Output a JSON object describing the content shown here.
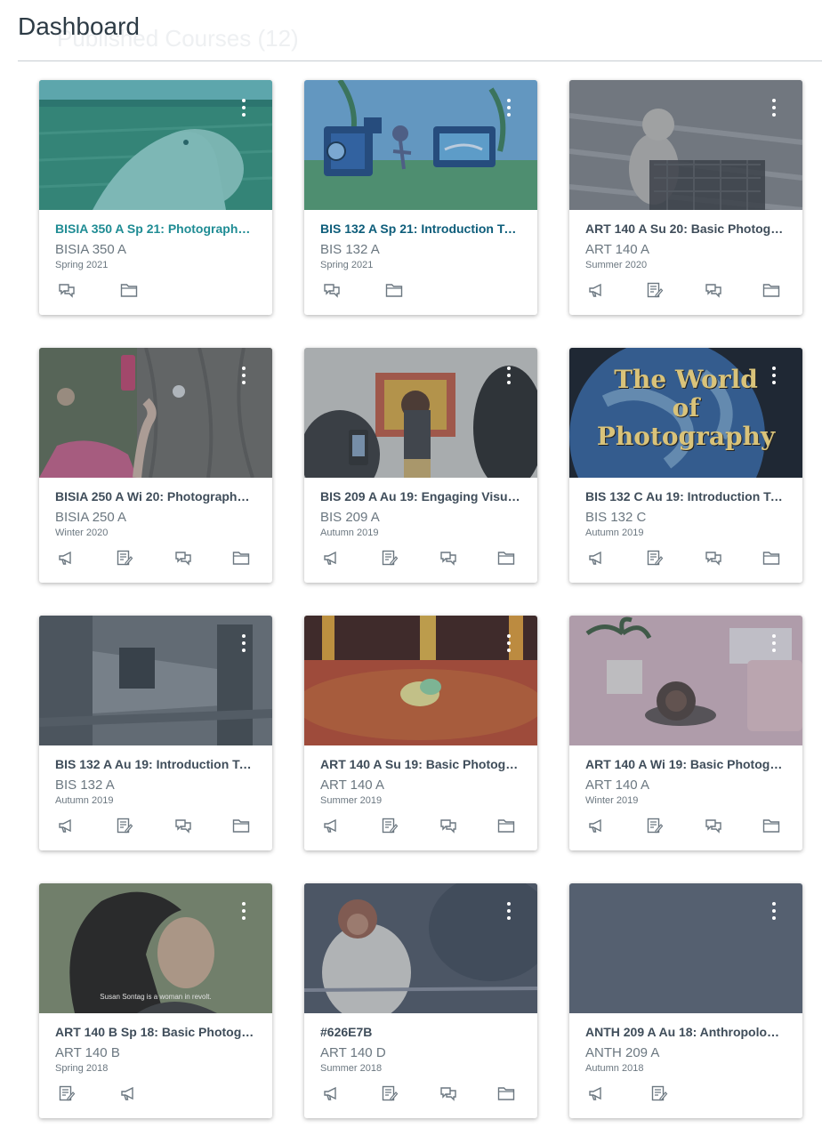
{
  "header": {
    "title": "Dashboard",
    "ghost_title": "Published Courses (12)"
  },
  "cards": [
    {
      "name": "BISIA 350 A Sp 21: Photography A...",
      "code": "BISIA 350 A",
      "term": "Spring 2021",
      "color": "#1f8c94",
      "actions": [
        "discussions-icon",
        "files-icon"
      ]
    },
    {
      "name": "BIS 132 A Sp 21: Introduction To P...",
      "code": "BIS 132 A",
      "term": "Spring 2021",
      "color": "#0d5d7a",
      "actions": [
        "discussions-icon",
        "files-icon"
      ]
    },
    {
      "name": "ART 140 A Su 20: Basic Photograp...",
      "code": "ART 140 A",
      "term": "Summer 2020",
      "color": "#3f4d5a",
      "actions": [
        "announcements-icon",
        "assignments-icon",
        "discussions-icon",
        "files-icon"
      ]
    },
    {
      "name": "BISIA 250 A Wi 20: Photography ...",
      "code": "BISIA 250 A",
      "term": "Winter 2020",
      "color": "#3f4d5a",
      "actions": [
        "announcements-icon",
        "assignments-icon",
        "discussions-icon",
        "files-icon"
      ]
    },
    {
      "name": "BIS 209 A Au 19: Engaging Visual ...",
      "code": "BIS 209 A",
      "term": "Autumn 2019",
      "color": "#3f4d5a",
      "actions": [
        "announcements-icon",
        "assignments-icon",
        "discussions-icon",
        "files-icon"
      ]
    },
    {
      "name": "BIS 132 C Au 19: Introduction To ...",
      "code": "BIS 132 C",
      "term": "Autumn 2019",
      "color": "#3f4d5a",
      "actions": [
        "announcements-icon",
        "assignments-icon",
        "discussions-icon",
        "files-icon"
      ]
    },
    {
      "name": "BIS 132 A Au 19: Introduction To ...",
      "code": "BIS 132 A",
      "term": "Autumn 2019",
      "color": "#3f4d5a",
      "actions": [
        "announcements-icon",
        "assignments-icon",
        "discussions-icon",
        "files-icon"
      ]
    },
    {
      "name": "ART 140 A Su 19: Basic Photograp...",
      "code": "ART 140 A",
      "term": "Summer 2019",
      "color": "#3f4d5a",
      "actions": [
        "announcements-icon",
        "assignments-icon",
        "discussions-icon",
        "files-icon"
      ]
    },
    {
      "name": "ART 140 A Wi 19: Basic Photogra...",
      "code": "ART 140 A",
      "term": "Winter 2019",
      "color": "#3f4d5a",
      "actions": [
        "announcements-icon",
        "assignments-icon",
        "discussions-icon",
        "files-icon"
      ]
    },
    {
      "name": "ART 140 B Sp 18: Basic Photograp...",
      "code": "ART 140 B",
      "term": "Spring 2018",
      "color": "#3f4d5a",
      "actions": [
        "assignments-icon",
        "announcements-icon"
      ]
    },
    {
      "name": "#626E7B",
      "code": "ART 140 D",
      "term": "Summer 2018",
      "color": "#3f4d5a",
      "actions": [
        "announcements-icon",
        "assignments-icon",
        "discussions-icon",
        "files-icon"
      ]
    },
    {
      "name": "ANTH 209 A Au 18: Anthropology...",
      "code": "ANTH 209 A",
      "term": "Autumn 2018",
      "color": "#3f4d5a",
      "actions": [
        "announcements-icon",
        "assignments-icon"
      ]
    }
  ],
  "hero_texts": {
    "world_line1": "The World",
    "world_line2": "of",
    "world_line3": "Photography",
    "sontag_caption": "Susan Sontag is a woman in revolt."
  },
  "colors": {
    "text_primary": "#2d3b45",
    "text_secondary": "#6b7780",
    "divider": "#c7cdd1",
    "card_tint_teal": "#1f8c94",
    "card_tint_blue": "#3a6a9a",
    "card_tint_slate": "#4f5e6e"
  }
}
